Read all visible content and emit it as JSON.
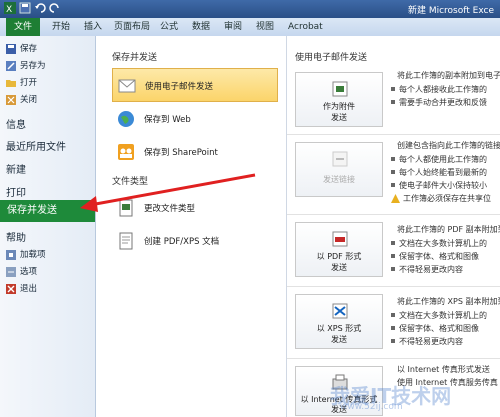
{
  "window": {
    "title": "新建 Microsoft Exce"
  },
  "ribbon": {
    "tabs": [
      "文件",
      "开始",
      "插入",
      "页面布局",
      "公式",
      "数据",
      "审阅",
      "视图",
      "Acrobat"
    ]
  },
  "sidebar": {
    "small_items": [
      {
        "label": "保存",
        "icon": "save-icon"
      },
      {
        "label": "另存为",
        "icon": "save-as-icon"
      },
      {
        "label": "打开",
        "icon": "open-folder-icon"
      },
      {
        "label": "关闭",
        "icon": "close-icon"
      }
    ],
    "big_items": [
      "信息",
      "最近所用文件",
      "新建",
      "打印"
    ],
    "active_item": "保存并发送",
    "help": "帮助",
    "bottom_items": [
      {
        "label": "加载项",
        "icon": "addin-icon"
      },
      {
        "label": "选项",
        "icon": "options-icon"
      },
      {
        "label": "退出",
        "icon": "exit-icon"
      }
    ]
  },
  "middle": {
    "section1_title": "保存并发送",
    "section1_items": [
      {
        "label": "使用电子邮件发送",
        "icon": "email-icon",
        "selected": true
      },
      {
        "label": "保存到 Web",
        "icon": "web-globe-icon"
      },
      {
        "label": "保存到 SharePoint",
        "icon": "sharepoint-icon"
      }
    ],
    "section2_title": "文件类型",
    "section2_items": [
      {
        "label": "更改文件类型",
        "icon": "change-type-icon"
      },
      {
        "label": "创建 PDF/XPS 文档",
        "icon": "pdf-doc-icon"
      }
    ]
  },
  "right": {
    "title": "使用电子邮件发送",
    "options": [
      {
        "button": [
          "作为附件",
          "发送"
        ],
        "disabled": false,
        "desc": [
          "将此工作簿的副本附加到电子"
        ],
        "bullets": [
          "每个人都接收此工作簿的",
          "需要手动合并更改和反馈"
        ]
      },
      {
        "button": [
          "发送链接"
        ],
        "disabled": true,
        "desc": [
          "创建包含指向此工作簿的链接"
        ],
        "bullets": [
          "每个人都使用此工作簿的",
          "每个人始终能看到最新的",
          "使电子邮件大小保持较小"
        ],
        "warning": "工作簿必须保存在共享位"
      },
      {
        "button": [
          "以 PDF 形式",
          "发送"
        ],
        "disabled": false,
        "desc": [
          "将此工作簿的 PDF 副本附加到"
        ],
        "bullets": [
          "文档在大多数计算机上的",
          "保留字体、格式和图像",
          "不得轻易更改内容"
        ]
      },
      {
        "button": [
          "以 XPS 形式",
          "发送"
        ],
        "disabled": false,
        "desc": [
          "将此工作簿的 XPS 副本附加到"
        ],
        "bullets": [
          "文档在大多数计算机上的",
          "保留字体、格式和图像",
          "不得轻易更改内容"
        ]
      },
      {
        "button": [
          "以 Internet 传真形式",
          "发送"
        ],
        "disabled": false,
        "desc": [
          "以 Internet 传真形式发送",
          "使用 Internet 传真服务传真"
        ],
        "bullets": []
      }
    ]
  },
  "watermark": {
    "main": "我爱IT技术网",
    "sub": "www.52ij.com"
  },
  "colors": {
    "file_tab": "#1e7e34",
    "active_item": "#1e8a3a",
    "selected_item": "#fbd46a",
    "arrow": "#e02020"
  }
}
